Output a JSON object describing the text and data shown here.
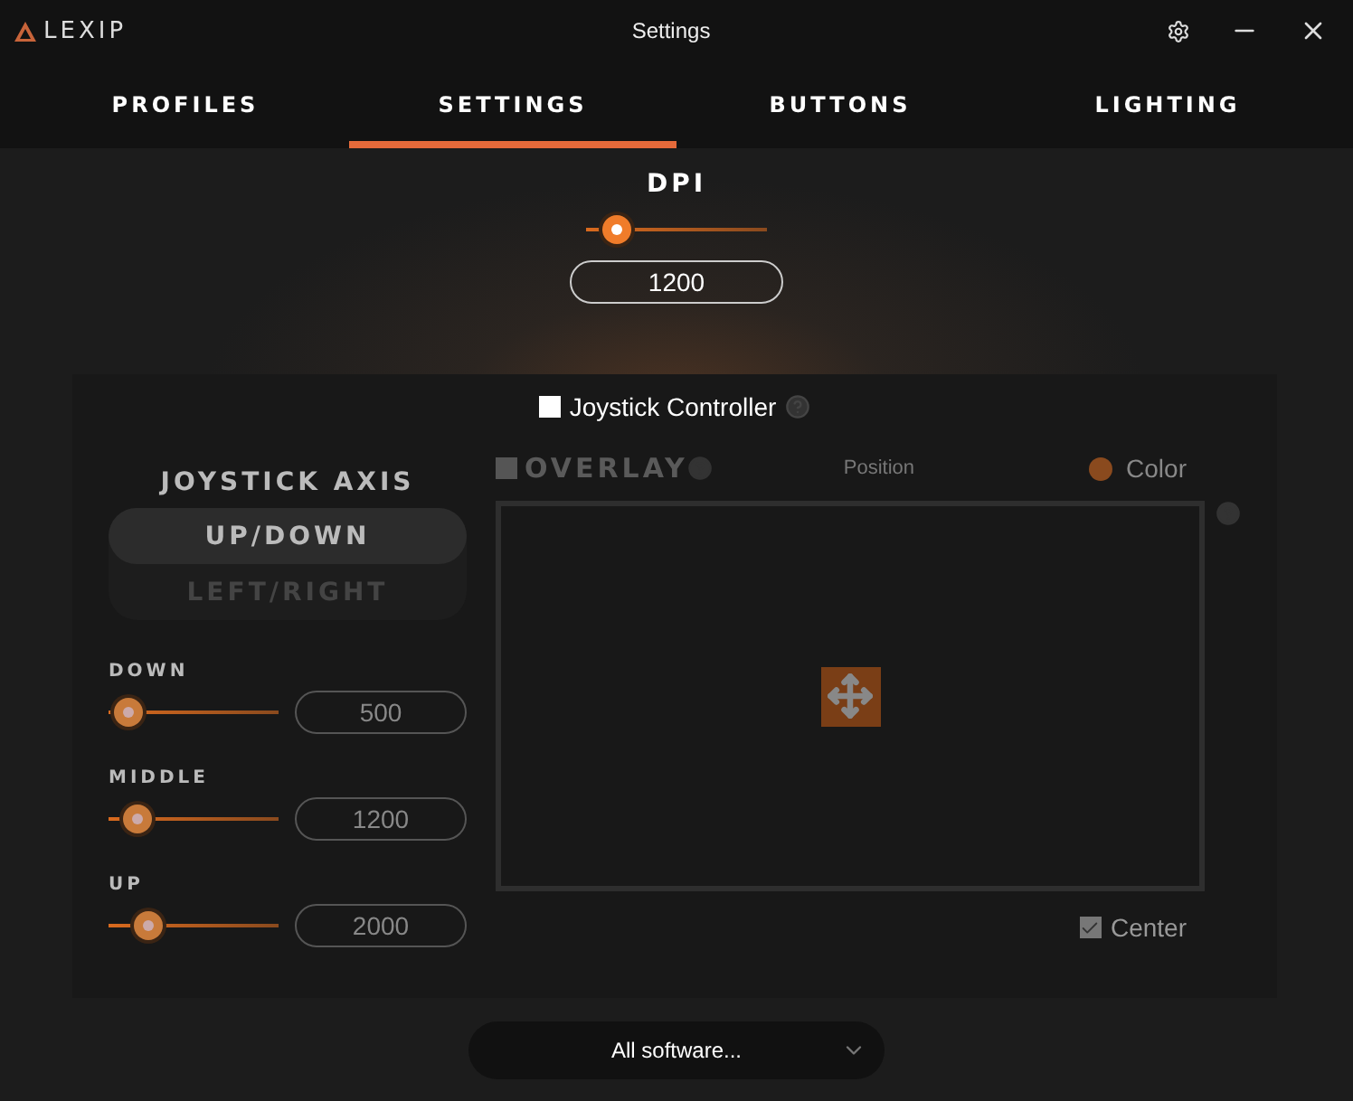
{
  "window": {
    "brand": "LEXIP",
    "title": "Settings"
  },
  "tabs": [
    {
      "label": "PROFILES",
      "selected": false
    },
    {
      "label": "SETTINGS",
      "selected": true
    },
    {
      "label": "BUTTONS",
      "selected": false
    },
    {
      "label": "LIGHTING",
      "selected": false
    }
  ],
  "dpi": {
    "label": "DPI",
    "level": 0.17,
    "value": "1200"
  },
  "joystick_controller": {
    "label": "Joystick Controller",
    "checked": false
  },
  "joystick_axis": {
    "title": "JOYSTICK AXIS",
    "options": [
      {
        "label": "UP/DOWN",
        "selected": true
      },
      {
        "label": "LEFT/RIGHT",
        "selected": false
      }
    ],
    "sliders": [
      {
        "label": "DOWN",
        "level": 0.12,
        "value": "500"
      },
      {
        "label": "MIDDLE",
        "level": 0.17,
        "value": "1200"
      },
      {
        "label": "UP",
        "level": 0.23,
        "value": "2000"
      }
    ]
  },
  "overlay": {
    "label": "OVERLAY",
    "checked": false,
    "disabled": true,
    "position_label": "Position",
    "color_label": "Color",
    "color": "#8a4a1e",
    "center": {
      "label": "Center",
      "checked": true
    }
  },
  "software_select": {
    "value": "All software..."
  }
}
